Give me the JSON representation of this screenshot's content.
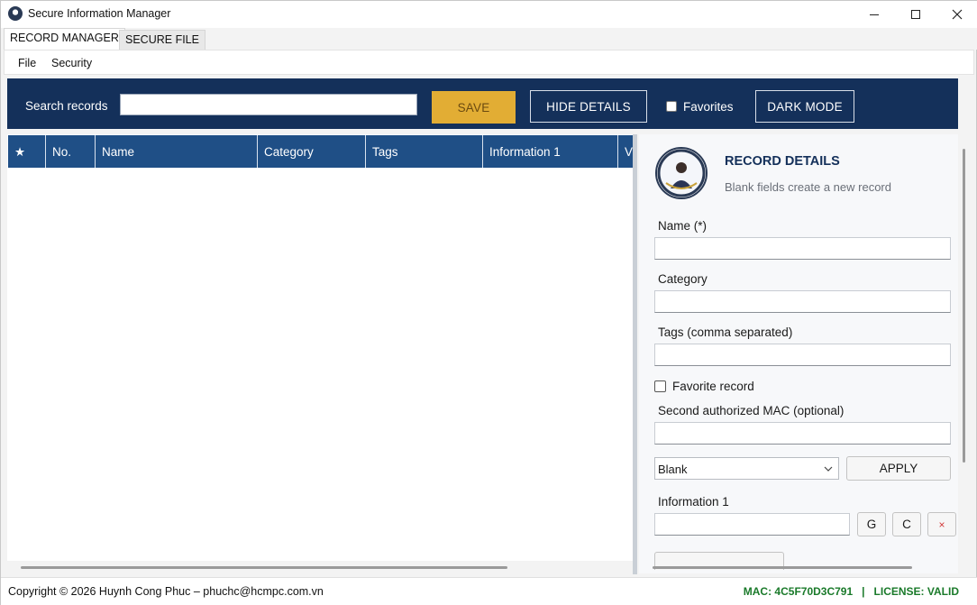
{
  "window": {
    "title": "Secure Information Manager"
  },
  "tabs": [
    {
      "label": "RECORD MANAGER",
      "active": true
    },
    {
      "label": "SECURE FILE",
      "active": false
    }
  ],
  "menu": {
    "items": [
      "File",
      "Security"
    ]
  },
  "toolbar": {
    "search_label": "Search records",
    "search_value": "",
    "save_label": "SAVE",
    "hide_details_label": "HIDE DETAILS",
    "favorites_label": "Favorites",
    "favorites_checked": false,
    "dark_mode_label": "DARK MODE"
  },
  "grid": {
    "columns": [
      "★",
      "No.",
      "Name",
      "Category",
      "Tags",
      "Information 1",
      "V"
    ],
    "rows": []
  },
  "details": {
    "title": "RECORD DETAILS",
    "subtitle": "Blank fields create a new record",
    "name_label": "Name (*)",
    "category_label": "Category",
    "tags_label": "Tags (comma separated)",
    "favorite_label": "Favorite record",
    "mac_label": "Second authorized MAC (optional)",
    "template_value": "Blank",
    "apply_label": "APPLY",
    "info1_label": "Information 1",
    "gen_label": "G",
    "copy_label": "C",
    "clear_label": "×"
  },
  "status": {
    "copyright": "Copyright © 2026 Huynh Cong Phuc – phuchc@hcmpc.com.vn",
    "mac": "MAC: 4C5F70D3C791",
    "separator": "|",
    "license": "LICENSE: VALID"
  },
  "colors": {
    "toolbar_bg": "#14305a",
    "grid_header_bg": "#1f4f86",
    "save_button": "#e2ad34",
    "status_ok": "#1a7a2a"
  }
}
